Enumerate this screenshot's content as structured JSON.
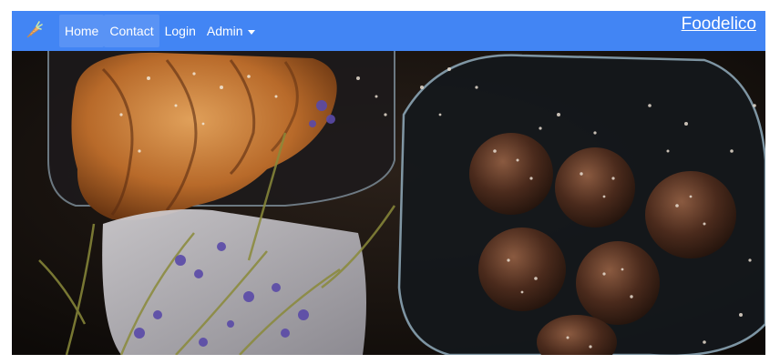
{
  "navbar": {
    "logo_icon": "carrot-icon",
    "items": [
      {
        "label": "Home"
      },
      {
        "label": "Contact"
      },
      {
        "label": "Login"
      },
      {
        "label": "Admin"
      }
    ],
    "brand": "Foodelico",
    "color": "#4285f4"
  },
  "hero": {
    "image": "food-photo-croissant-chocolate-balls"
  }
}
